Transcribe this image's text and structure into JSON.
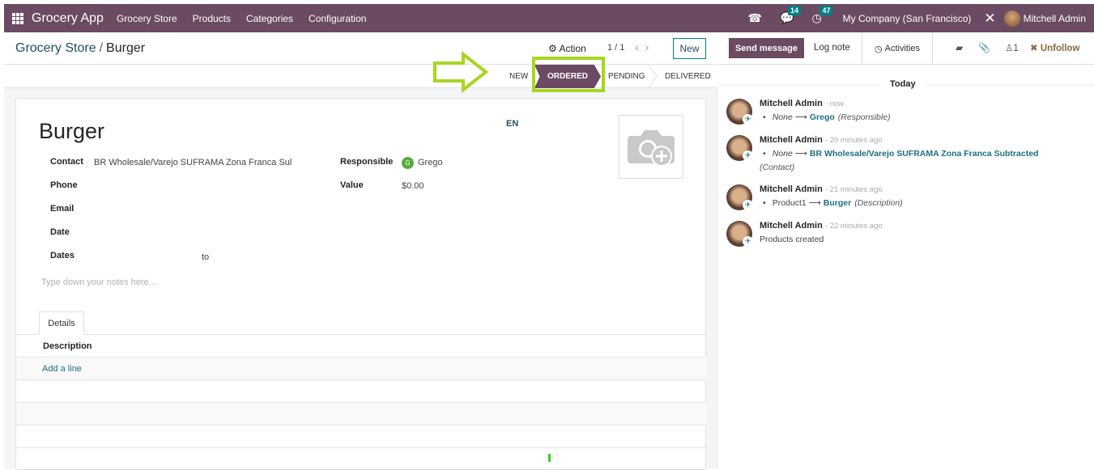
{
  "topbar": {
    "app_name": "Grocery App",
    "menu": [
      "Grocery Store",
      "Products",
      "Categories",
      "Configuration"
    ],
    "messages_count": "14",
    "activities_count": "47",
    "company": "My Company (San Francisco)",
    "user": "Mitchell Admin",
    "brand_color": "#6b4a63"
  },
  "control_panel": {
    "breadcrumb_parent": "Grocery Store",
    "breadcrumb_separator": "/",
    "breadcrumb_current": "Burger",
    "action_label": "Action",
    "pager": "1 / 1",
    "new_label": "New"
  },
  "statusbar": {
    "stages": [
      "NEW",
      "ORDERED",
      "PENDING",
      "DELIVERED"
    ],
    "current": "ORDERED",
    "highlight_color": "#a6d71e"
  },
  "form": {
    "title": "Burger",
    "lang": "EN",
    "fields": {
      "contact_label": "Contact",
      "contact_value": "BR Wholesale/Varejo SUFRAMA Zona Franca Sul",
      "phone_label": "Phone",
      "email_label": "Email",
      "date_label": "Date",
      "dates_label": "Dates",
      "dates_to": "to",
      "responsible_label": "Responsible",
      "responsible_initial": "G",
      "responsible_value": "Grego",
      "value_label": "Value",
      "value_value": "$0.00"
    },
    "notes_placeholder": "Type down your notes here...",
    "tabs": [
      "Details"
    ],
    "lines_header": "Description",
    "add_line": "Add a line"
  },
  "chatter": {
    "send_message": "Send message",
    "log_note": "Log note",
    "activities": "Activities",
    "followers_count": "1",
    "unfollow": "Unfollow",
    "today": "Today",
    "messages": [
      {
        "author": "Mitchell Admin",
        "date": "- now",
        "old": "None",
        "new": "Grego",
        "field": "(Responsible)"
      },
      {
        "author": "Mitchell Admin",
        "date": "- 20 minutes ago",
        "old": "None",
        "new": "BR Wholesale/Varejo SUFRAMA Zona Franca Subtracted",
        "field": "(Contact)"
      },
      {
        "author": "Mitchell Admin",
        "date": "- 21 minutes ago",
        "old": "Product1",
        "new": "Burger",
        "field": "(Description)"
      },
      {
        "author": "Mitchell Admin",
        "date": "- 22 minutes ago",
        "body": "Products created"
      }
    ]
  }
}
